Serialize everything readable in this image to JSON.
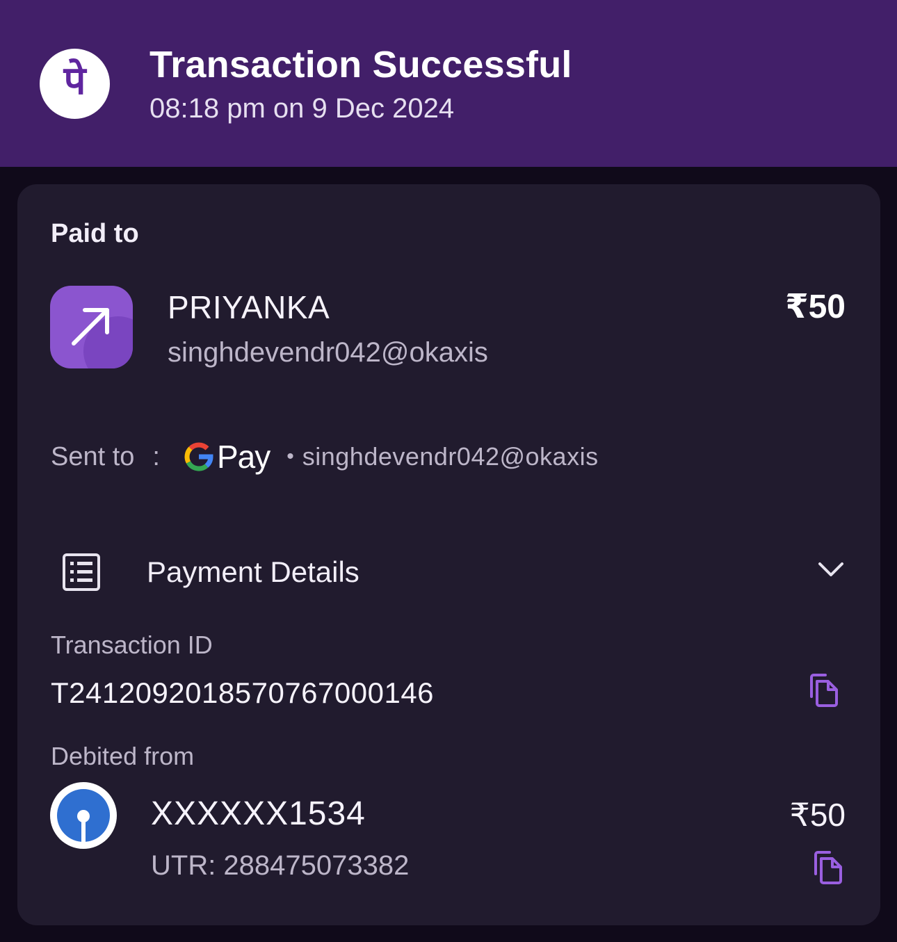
{
  "header": {
    "logo_glyph": "पे",
    "title": "Transaction Successful",
    "datetime": "08:18 pm on 9 Dec 2024",
    "bg_color": "#421f69"
  },
  "paid_to": {
    "label": "Paid to",
    "icon": "arrow-up-right-icon",
    "name": "PRIYANKA",
    "vpa": "singhdevendr042@okaxis",
    "amount": "₹50"
  },
  "sent_to": {
    "label": "Sent to",
    "separator": ":",
    "app_name": "Pay",
    "app_icon": "google-pay-icon",
    "vpa": "singhdevendr042@okaxis"
  },
  "payment_details": {
    "label": "Payment Details",
    "icon": "receipt-list-icon",
    "toggle_icon": "chevron-down-icon",
    "transaction_id_label": "Transaction ID",
    "transaction_id": "T2412092018570767000146",
    "debited_from_label": "Debited from",
    "account": "XXXXXX1534",
    "utr": "UTR: 288475073382",
    "debit_amount": "₹50",
    "bank_icon": "bank-logo-icon"
  },
  "colors": {
    "accent": "#8b55cf",
    "card_bg": "#211b2e",
    "page_bg": "#100a1a"
  }
}
